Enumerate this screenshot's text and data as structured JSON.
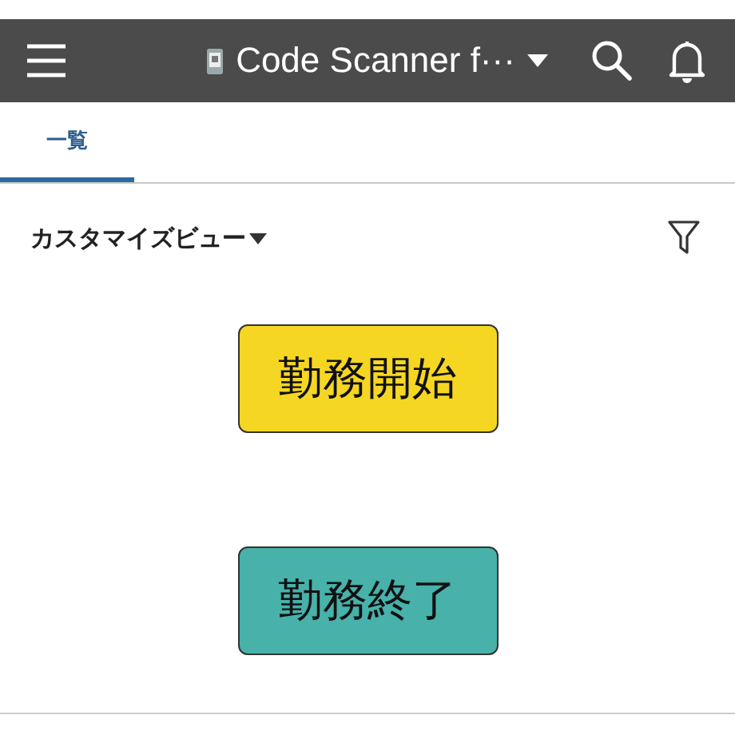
{
  "header": {
    "title": "Code Scanner f···"
  },
  "tabs": [
    {
      "label": "一覧",
      "selected": true
    }
  ],
  "view": {
    "label": "カスタマイズビュー"
  },
  "actions": [
    {
      "label": "勤務開始",
      "color": "#f5d623"
    },
    {
      "label": "勤務終了",
      "color": "#47b1aa"
    }
  ]
}
